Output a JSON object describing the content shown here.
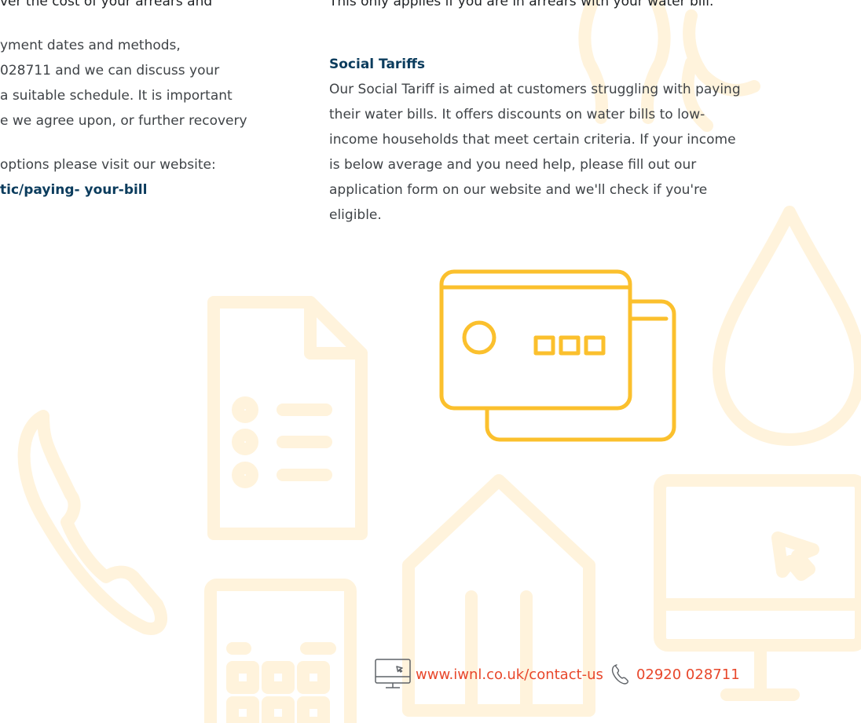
{
  "left_column": {
    "line_1": "ver the cost of your arrears and",
    "line_2": "yment dates and methods,",
    "line_3": "028711 and we can discuss your",
    "line_4": "a suitable schedule. It is important",
    "line_5": "e we agree upon, or further recovery",
    "line_6": "options please visit our website:",
    "link": "tic/paying- your-bill"
  },
  "right_column": {
    "intro": "This only applies if you are in arrears with your water bill.",
    "heading": "Social Tariffs",
    "paragraph_lines": [
      "Our Social Tariff is aimed at customers struggling with paying",
      "their water bills. It offers discounts on water bills to low-",
      "income households that meet certain criteria. If your income",
      "is below average and you need help, please fill out our",
      "application form on our website and we'll check if you're",
      "eligible."
    ]
  },
  "contact": {
    "website": "www.iwnl.co.uk/contact-us",
    "phone": "02920 028711",
    "website_icon": "computer-icon",
    "phone_icon": "phone-icon"
  },
  "illustration": {
    "icon": "payment-cards-icon"
  },
  "colors": {
    "accent_yellow": "#fbc02d",
    "faint_yellow": "#fff3dc",
    "link_blue": "#0b3c5d",
    "contact_red": "#e8472b",
    "body_text": "#3f4347"
  }
}
